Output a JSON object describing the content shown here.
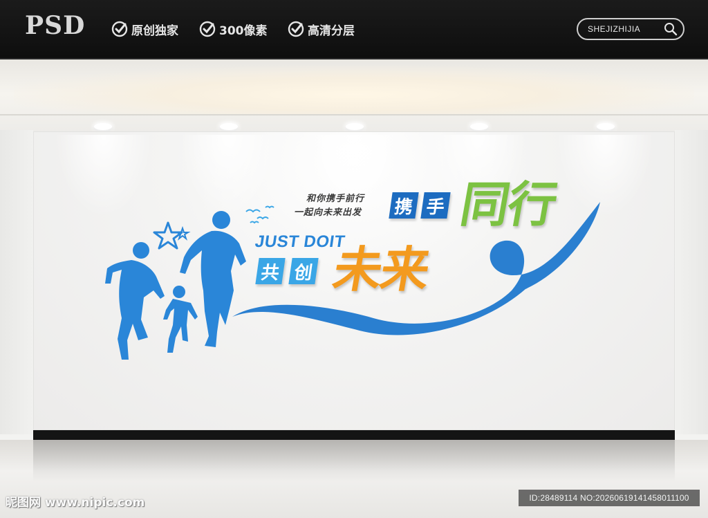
{
  "header": {
    "logo": "PSD",
    "features": [
      "原创独家",
      "300像素",
      "高清分层"
    ],
    "search_label": "SHEJIZHIJIA",
    "check_icon": "check-circle-icon",
    "search_icon": "magnifier-icon"
  },
  "artwork": {
    "slogan_lines": [
      "和你携手前行",
      "一起向未来出发"
    ],
    "english": "JUST DOIT",
    "boxed_top": [
      "携",
      "手"
    ],
    "big_top": "同行",
    "boxed_bottom": [
      "共",
      "创"
    ],
    "big_bottom": "未来",
    "colors": {
      "blue": "#2a86d8",
      "dark_blue": "#1d6cc0",
      "sky_blue": "#3aa6e6",
      "green": "#7cc242",
      "orange": "#f39a1e"
    }
  },
  "footer": {
    "watermark_left": "昵图网 www.nipic.com",
    "id_text": "ID:28489114 NO:20260619141458011100"
  }
}
